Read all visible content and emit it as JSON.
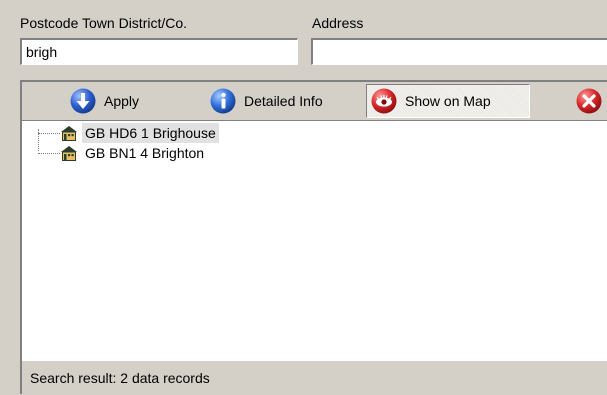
{
  "fields": {
    "postcode_label": "Postcode Town District/Co.",
    "postcode_value": "brigh",
    "address_label": "Address",
    "address_value": ""
  },
  "toolbar": {
    "apply": {
      "label": "Apply",
      "icon": "info-down-arrow-icon",
      "color": "#2f5fd0"
    },
    "detailed_info": {
      "label": "Detailed Info",
      "icon": "info-icon",
      "color": "#2f6fd8"
    },
    "show_on_map": {
      "label": "Show on Map",
      "icon": "eye-icon",
      "color": "#d8282a",
      "pressed": true
    },
    "close": {
      "icon": "close-icon",
      "color": "#d8282a"
    }
  },
  "results": [
    {
      "label": "GB HD6 1 Brighouse",
      "selected": true,
      "icon": "house-icon"
    },
    {
      "label": "GB BN1 4 Brighton",
      "selected": false,
      "icon": "house-icon"
    }
  ],
  "status": {
    "text": "Search result: 2 data records"
  }
}
